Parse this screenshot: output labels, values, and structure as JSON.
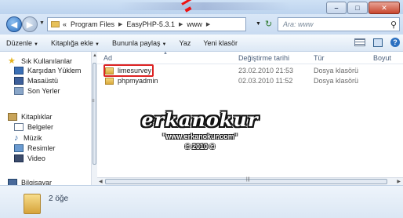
{
  "titlebar": {
    "buttons": [
      {
        "name": "minimize",
        "glyph": "–"
      },
      {
        "name": "maximize",
        "glyph": "□"
      },
      {
        "name": "close",
        "glyph": "✕"
      }
    ]
  },
  "address": {
    "prefix": "«",
    "crumbs": [
      "Program Files",
      "EasyPHP-5.3.1",
      "www"
    ],
    "search_placeholder": "Ara: www"
  },
  "toolbar": {
    "items": [
      "Düzenle",
      "Kitaplığa ekle",
      "Bununla paylaş",
      "Yaz",
      "Yeni klasör"
    ]
  },
  "navpane": {
    "favorites": "Sık Kullanılanlar",
    "downloads": "Karşıdan Yüklem",
    "desktop": "Masaüstü",
    "recent": "Son Yerler",
    "libraries": "Kitaplıklar",
    "documents": "Belgeler",
    "music": "Müzik",
    "pictures": "Resimler",
    "video": "Video",
    "computer": "Bilgisayar"
  },
  "columns": {
    "name": "Ad",
    "date": "Değiştirme tarihi",
    "type": "Tür",
    "size": "Boyut"
  },
  "files": [
    {
      "name": "limesurvey",
      "date": "23.02.2010 21:53",
      "type": "Dosya klasörü"
    },
    {
      "name": "phpmyadmin",
      "date": "02.03.2010 11:52",
      "type": "Dosya klasörü"
    }
  ],
  "watermark": {
    "line1": "erkanokur",
    "line2": "\"www.erkanokur.com\"",
    "line3": "© 2010 ©"
  },
  "status": {
    "item_count": "2 öğe"
  }
}
